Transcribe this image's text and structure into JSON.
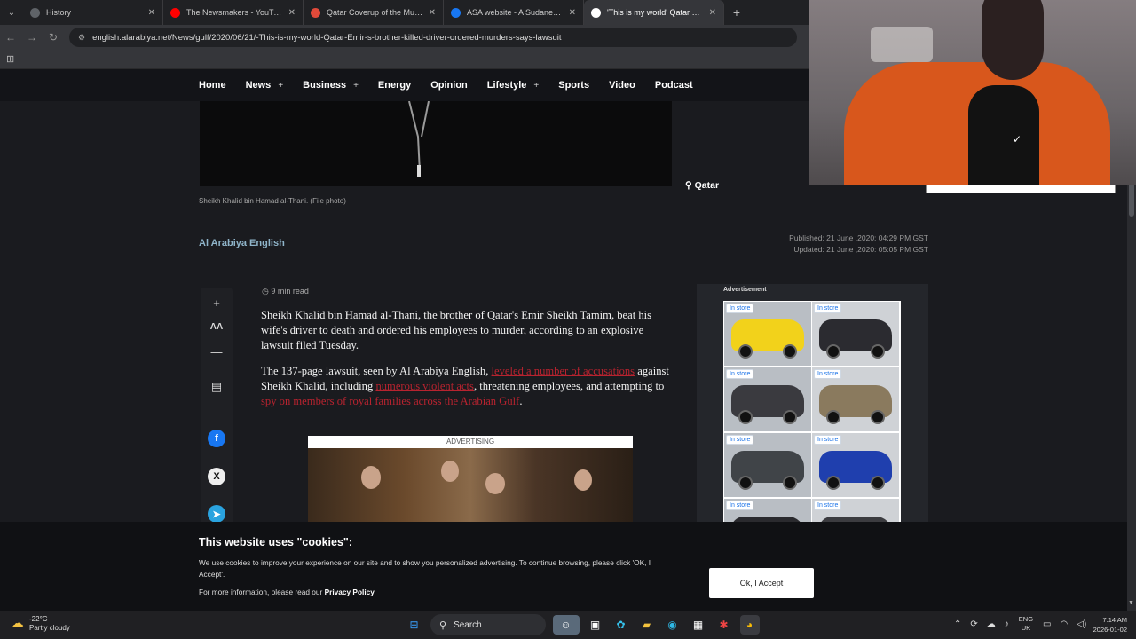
{
  "browser": {
    "tabs": [
      {
        "title": "History",
        "favicon_color": "#5f6368",
        "active": false
      },
      {
        "title": "The Newsmakers - YouTube",
        "favicon_color": "#ff0000",
        "active": false
      },
      {
        "title": "Qatar Coverup of the Murder o",
        "favicon_color": "#e04a3a",
        "active": false
      },
      {
        "title": "ASA website - A Sudanese bod",
        "favicon_color": "#1877f2",
        "active": false
      },
      {
        "title": "'This is my world' Qatar Emir's",
        "favicon_color": "#ffffff",
        "active": true
      }
    ],
    "url": "english.alarabiya.net/News/gulf/2020/06/21/-This-is-my-world-Qatar-Emir-s-brother-killed-driver-ordered-murders-says-lawsuit"
  },
  "site_nav": {
    "items": [
      {
        "label": "Home",
        "has_plus": false
      },
      {
        "label": "News",
        "has_plus": true
      },
      {
        "label": "Business",
        "has_plus": true
      },
      {
        "label": "Energy",
        "has_plus": false
      },
      {
        "label": "Opinion",
        "has_plus": false
      },
      {
        "label": "Lifestyle",
        "has_plus": true
      },
      {
        "label": "Sports",
        "has_plus": false
      },
      {
        "label": "Video",
        "has_plus": false
      },
      {
        "label": "Podcast",
        "has_plus": false
      }
    ]
  },
  "article": {
    "photo_caption": "Sheikh Khalid bin Hamad al-Thani. (File photo)",
    "tag": "Qatar",
    "source": "Al Arabiya English",
    "published": "Published: 21 June ,2020: 04:29 PM GST",
    "updated": "Updated: 21 June ,2020: 05:05 PM GST",
    "read_time": "9 min read",
    "p1": "Sheikh Khalid bin Hamad al-Thani, the brother of Qatar's Emir Sheikh Tamim, beat his wife's driver to death and ordered his employees to murder, according to an explosive lawsuit filed Tuesday.",
    "p2_a": "The 137-page lawsuit, seen by Al Arabiya English, ",
    "p2_link1": "leveled a number of accusations",
    "p2_b": " against Sheikh Khalid, including ",
    "p2_link2": "numerous violent acts",
    "p2_c": ", threatening employees, and attempting to ",
    "p2_link3": "spy on members of royal families across the Arabian Gulf",
    "p2_d": ".",
    "ad_label": "ADVERTISING"
  },
  "share": {
    "plus": "+",
    "font_size": "AA",
    "minus": "—"
  },
  "sidebar_ad": {
    "title": "Advertisement",
    "badge": "In store",
    "cars": [
      {
        "color": "#f2d21b"
      },
      {
        "color": "#2b2b30"
      },
      {
        "color": "#3a3a3f"
      },
      {
        "color": "#8a7a5e"
      },
      {
        "color": "#404448"
      },
      {
        "color": "#1f3fae"
      },
      {
        "color": "#2a2a2e"
      },
      {
        "color": "#3c3c40"
      }
    ]
  },
  "cookie_banner": {
    "heading": "This website uses \"cookies\":",
    "text": "We use cookies to improve your experience on our site and to show you personalized advertising. To continue browsing, please click 'OK, I Accept'.",
    "more_prefix": "For more information, please read our ",
    "more_link": "Privacy Policy",
    "accept": "Ok, I Accept"
  },
  "taskbar": {
    "temp": "-22°C",
    "weather": "Partly cloudy",
    "search": "Search",
    "lang_top": "ENG",
    "lang_bottom": "UK",
    "time": "7:14 AM",
    "date": "2026-01-02"
  }
}
